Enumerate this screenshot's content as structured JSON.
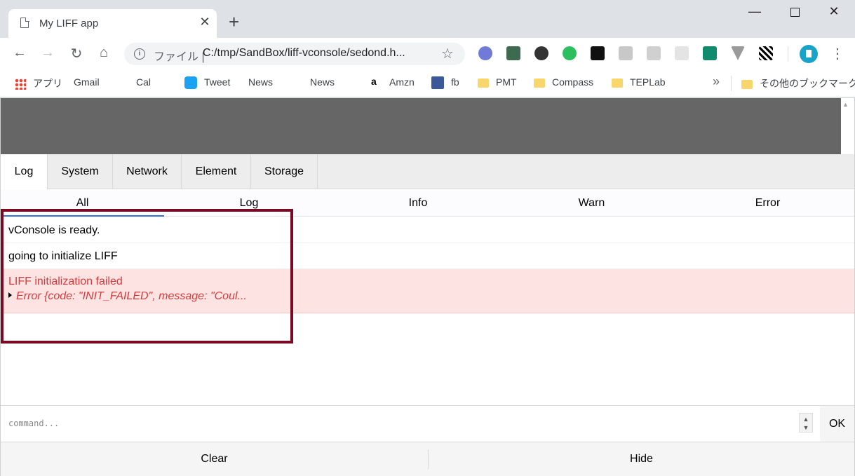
{
  "browser": {
    "tab_title": "My LIFF app",
    "tab_close": "✕",
    "new_tab": "+",
    "window": {
      "minimize": "—",
      "close": "✕"
    },
    "address": {
      "scheme": "ファイル |",
      "url": "C:/tmp/SandBox/liff-vconsole/sedond.h...",
      "star": "☆"
    },
    "nav": {
      "back": "←",
      "forward": "→",
      "reload": "↻",
      "home": "⌂"
    },
    "menu": "⋮",
    "bookmarks": [
      {
        "label": "アプリ",
        "icon": "apps-grid-icon"
      },
      {
        "label": "Gmail",
        "icon": "page-icon"
      },
      {
        "label": "Cal",
        "icon": "page-icon"
      },
      {
        "label": "Tweet",
        "icon": "twitter-icon"
      },
      {
        "label": "News",
        "icon": "page-icon"
      },
      {
        "label": "News",
        "icon": "page-icon"
      },
      {
        "label": "Amzn",
        "icon": "amazon-icon"
      },
      {
        "label": "fb",
        "icon": "facebook-icon"
      },
      {
        "label": "PMT",
        "icon": "folder-icon"
      },
      {
        "label": "Compass",
        "icon": "folder-icon"
      },
      {
        "label": "TEPLab",
        "icon": "folder-icon"
      }
    ],
    "bookmarks_more": "»",
    "other_bookmarks": "その他のブックマーク",
    "amazon_glyph": "a"
  },
  "vconsole": {
    "tabs": [
      "Log",
      "System",
      "Network",
      "Element",
      "Storage"
    ],
    "active_tab": "Log",
    "filters": [
      "All",
      "Log",
      "Info",
      "Warn",
      "Error"
    ],
    "active_filter": "All",
    "logs": [
      {
        "text": "vConsole is ready."
      },
      {
        "text": "going to initialize LIFF"
      },
      {
        "text": "LIFF initialization failed",
        "detail": "Error {code: \"INIT_FAILED\", message: \"Coul...",
        "level": "error"
      }
    ],
    "command_placeholder": "command...",
    "ok_label": "OK",
    "clear_label": "Clear",
    "hide_label": "Hide"
  },
  "colors": {
    "error_bg": "#fee3e3",
    "error_text": "#d33c3c",
    "highlight_border": "#7a0a23",
    "active_filter_underline": "#3370d8"
  }
}
